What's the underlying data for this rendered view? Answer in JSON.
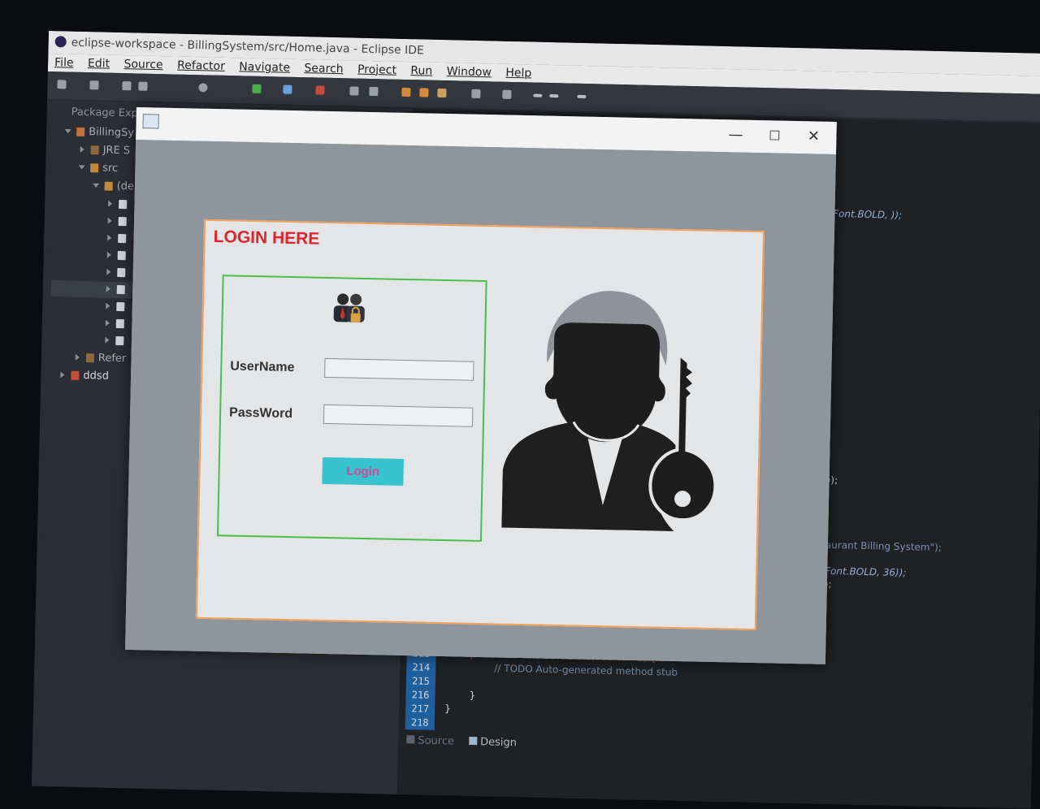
{
  "ide": {
    "window_title": "eclipse-workspace - BillingSystem/src/Home.java - Eclipse IDE",
    "menu": [
      "File",
      "Edit",
      "Source",
      "Refactor",
      "Navigate",
      "Search",
      "Project",
      "Run",
      "Window",
      "Help"
    ],
    "package_explorer_title": "Package Exp",
    "tree": [
      {
        "label": "BillingSy"
      },
      {
        "label": "JRE S"
      },
      {
        "label": "src"
      },
      {
        "label": "(de"
      },
      {
        "label": "Refer"
      },
      {
        "label": "ddsd"
      }
    ],
    "code_fragments": [
      "Font.BOLD,    ));",
      "));",
      "aurant Billing System\");",
      ";",
      "Font.BOLD, 36));",
      ");",
      "protected void setVisible(boolean b) {",
      "// TODO Auto-generated method stub",
      "}",
      "}"
    ],
    "line_numbers": [
      "213",
      "214",
      "215",
      "216",
      "217",
      "218"
    ],
    "bottom_tabs": [
      "Source",
      "Design"
    ]
  },
  "login_frame": {
    "controls": {
      "minimize": "—",
      "maximize": "☐",
      "close": "✕"
    },
    "heading": "LOGIN HERE",
    "username_label": "UserName",
    "password_label": "PassWord",
    "username_value": "",
    "password_value": "",
    "login_button": "Login",
    "colors": {
      "heading": "#e0242e",
      "panel_border": "#f0a25a",
      "form_border": "#46c04a",
      "button_bg": "#37c3cf",
      "button_text": "#d4469a"
    }
  }
}
